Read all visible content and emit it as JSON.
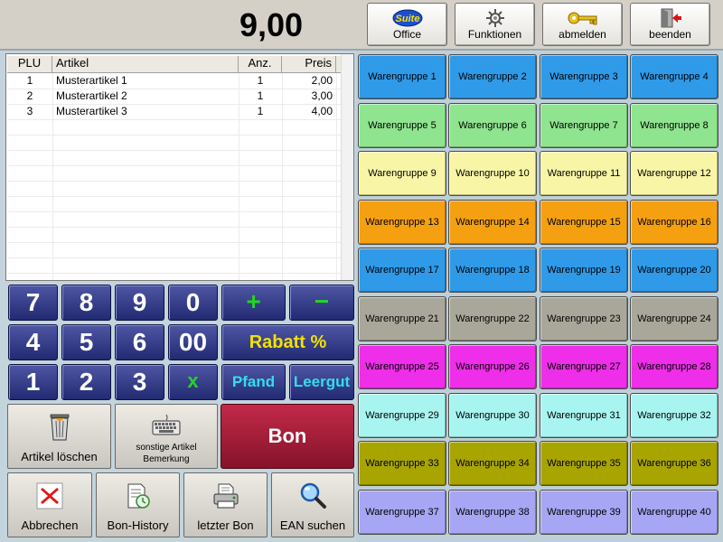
{
  "total": "9,00",
  "top_buttons": [
    {
      "label": "Office",
      "badge": "Suite",
      "icon": "suite-logo-icon"
    },
    {
      "label": "Funktionen",
      "icon": "gear-icon"
    },
    {
      "label": "abmelden",
      "icon": "key-icon"
    },
    {
      "label": "beenden",
      "icon": "exit-door-icon"
    }
  ],
  "list": {
    "headers": [
      "PLU",
      "Artikel",
      "Anz.",
      "Preis"
    ],
    "rows": [
      {
        "plu": "1",
        "artikel": "Musterartikel 1",
        "anz": "1",
        "preis": "2,00"
      },
      {
        "plu": "2",
        "artikel": "Musterartikel 2",
        "anz": "1",
        "preis": "3,00"
      },
      {
        "plu": "3",
        "artikel": "Musterartikel 3",
        "anz": "1",
        "preis": "4,00"
      }
    ]
  },
  "keypad": {
    "digits": [
      "7",
      "8",
      "9",
      "0",
      "4",
      "5",
      "6",
      "00",
      "1",
      "2",
      "3"
    ],
    "plus": "+",
    "minus": "−",
    "times": "x",
    "rabatt": "Rabatt %",
    "pfand": "Pfand",
    "leergut": "Leergut"
  },
  "actions": {
    "artikel_loeschen": "Artikel löschen",
    "sonstige_1": "sonstige Artikel",
    "sonstige_2": "Bemerkung",
    "bon": "Bon",
    "abbrechen": "Abbrechen",
    "bon_history": "Bon-History",
    "letzter_bon": "letzter Bon",
    "ean_suchen": "EAN suchen"
  },
  "warengruppen": [
    "Warengruppe 1",
    "Warengruppe 2",
    "Warengruppe 3",
    "Warengruppe 4",
    "Warengruppe 5",
    "Warengruppe 6",
    "Warengruppe 7",
    "Warengruppe 8",
    "Warengruppe 9",
    "Warengruppe 10",
    "Warengruppe 11",
    "Warengruppe 12",
    "Warengruppe 13",
    "Warengruppe 14",
    "Warengruppe 15",
    "Warengruppe 16",
    "Warengruppe 17",
    "Warengruppe 18",
    "Warengruppe 19",
    "Warengruppe 20",
    "Warengruppe 21",
    "Warengruppe 22",
    "Warengruppe 23",
    "Warengruppe 24",
    "Warengruppe 25",
    "Warengruppe 26",
    "Warengruppe 27",
    "Warengruppe 28",
    "Warengruppe 29",
    "Warengruppe 30",
    "Warengruppe 31",
    "Warengruppe 32",
    "Warengruppe 33",
    "Warengruppe 34",
    "Warengruppe 35",
    "Warengruppe 36",
    "Warengruppe 37",
    "Warengruppe 38",
    "Warengruppe 39",
    "Warengruppe 40"
  ],
  "row_colors": [
    "#2f9ae8",
    "#8fe48f",
    "#f8f6a6",
    "#f5a010",
    "#2f9ae8",
    "#a9a79a",
    "#ee2ee8",
    "#a8f4f0",
    "#a8a400",
    "#a6a6f4"
  ]
}
